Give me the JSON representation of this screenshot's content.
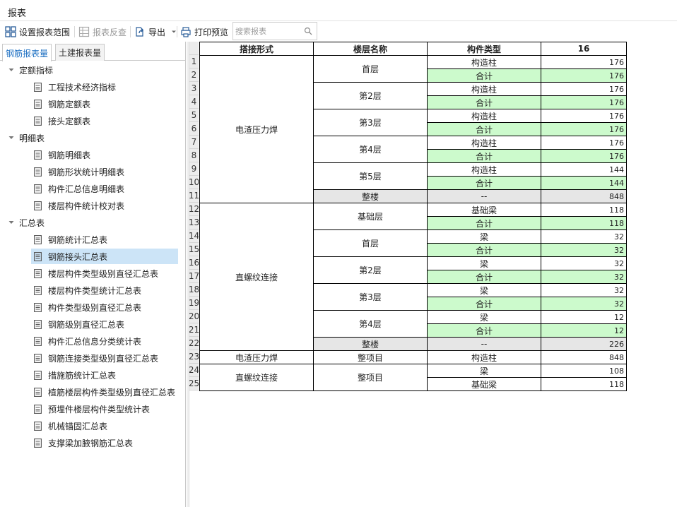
{
  "window": {
    "title": "报表"
  },
  "toolbar": {
    "set_range": "设置报表范围",
    "reverse_check": "报表反查",
    "export": "导出",
    "print_preview": "打印预览",
    "search_placeholder": "搜索报表"
  },
  "tabs": [
    {
      "label": "钢筋报表量",
      "active": true
    },
    {
      "label": "土建报表量",
      "active": false
    }
  ],
  "tree": [
    {
      "label": "定额指标",
      "items": [
        "工程技术经济指标",
        "钢筋定额表",
        "接头定额表"
      ]
    },
    {
      "label": "明细表",
      "items": [
        "钢筋明细表",
        "钢筋形状统计明细表",
        "构件汇总信息明细表",
        "楼层构件统计校对表"
      ]
    },
    {
      "label": "汇总表",
      "items": [
        "钢筋统计汇总表",
        "钢筋接头汇总表",
        "楼层构件类型级别直径汇总表",
        "楼层构件类型统计汇总表",
        "构件类型级别直径汇总表",
        "钢筋级别直径汇总表",
        "构件汇总信息分类统计表",
        "钢筋连接类型级别直径汇总表",
        "措施筋统计汇总表",
        "植筋楼层构件类型级别直径汇总表",
        "预埋件楼层构件类型统计表",
        "机械锚固汇总表",
        "支撑梁加腋钢筋汇总表"
      ]
    }
  ],
  "selected_item": "钢筋接头汇总表",
  "report": {
    "headers": [
      "搭接形式",
      "楼层名称",
      "构件类型",
      "16"
    ],
    "row_numbers": [
      "1",
      "2",
      "3",
      "4",
      "5",
      "6",
      "7",
      "8",
      "9",
      "10",
      "11",
      "12",
      "13",
      "14",
      "15",
      "16",
      "17",
      "18",
      "19",
      "20",
      "21",
      "22",
      "23",
      "24",
      "25"
    ],
    "groups": [
      {
        "method": "电渣压力焊",
        "floors": [
          {
            "name": "首层",
            "rows": [
              {
                "type": "构造柱",
                "value": "176",
                "kind": "normal"
              },
              {
                "type": "合计",
                "value": "176",
                "kind": "subtotal"
              }
            ]
          },
          {
            "name": "第2层",
            "rows": [
              {
                "type": "构造柱",
                "value": "176",
                "kind": "normal"
              },
              {
                "type": "合计",
                "value": "176",
                "kind": "subtotal"
              }
            ]
          },
          {
            "name": "第3层",
            "rows": [
              {
                "type": "构造柱",
                "value": "176",
                "kind": "normal"
              },
              {
                "type": "合计",
                "value": "176",
                "kind": "subtotal"
              }
            ]
          },
          {
            "name": "第4层",
            "rows": [
              {
                "type": "构造柱",
                "value": "176",
                "kind": "normal"
              },
              {
                "type": "合计",
                "value": "176",
                "kind": "subtotal"
              }
            ]
          },
          {
            "name": "第5层",
            "rows": [
              {
                "type": "构造柱",
                "value": "144",
                "kind": "normal"
              },
              {
                "type": "合计",
                "value": "144",
                "kind": "subtotal"
              }
            ]
          },
          {
            "name": "整楼",
            "rows": [
              {
                "type": "--",
                "value": "848",
                "kind": "whole"
              }
            ]
          }
        ]
      },
      {
        "method": "直螺纹连接",
        "floors": [
          {
            "name": "基础层",
            "rows": [
              {
                "type": "基础梁",
                "value": "118",
                "kind": "normal"
              },
              {
                "type": "合计",
                "value": "118",
                "kind": "subtotal"
              }
            ]
          },
          {
            "name": "首层",
            "rows": [
              {
                "type": "梁",
                "value": "32",
                "kind": "normal"
              },
              {
                "type": "合计",
                "value": "32",
                "kind": "subtotal"
              }
            ]
          },
          {
            "name": "第2层",
            "rows": [
              {
                "type": "梁",
                "value": "32",
                "kind": "normal"
              },
              {
                "type": "合计",
                "value": "32",
                "kind": "subtotal"
              }
            ]
          },
          {
            "name": "第3层",
            "rows": [
              {
                "type": "梁",
                "value": "32",
                "kind": "normal"
              },
              {
                "type": "合计",
                "value": "32",
                "kind": "subtotal"
              }
            ]
          },
          {
            "name": "第4层",
            "rows": [
              {
                "type": "梁",
                "value": "12",
                "kind": "normal"
              },
              {
                "type": "合计",
                "value": "12",
                "kind": "subtotal"
              }
            ]
          },
          {
            "name": "整楼",
            "rows": [
              {
                "type": "--",
                "value": "226",
                "kind": "whole"
              }
            ]
          }
        ]
      },
      {
        "method": "电渣压力焊",
        "floors": [
          {
            "name": "整项目",
            "rows": [
              {
                "type": "构造柱",
                "value": "848",
                "kind": "normal"
              }
            ]
          }
        ]
      },
      {
        "method": "直螺纹连接",
        "floors": [
          {
            "name": "整项目",
            "rows": [
              {
                "type": "梁",
                "value": "108",
                "kind": "normal"
              },
              {
                "type": "基础梁",
                "value": "118",
                "kind": "normal"
              }
            ]
          }
        ]
      }
    ]
  },
  "colors": {
    "subtotal_bg": "#ccfacc",
    "whole_bg": "#e6e6e6",
    "selected_bg": "#cce4f7",
    "accent": "#1c6fc2"
  }
}
